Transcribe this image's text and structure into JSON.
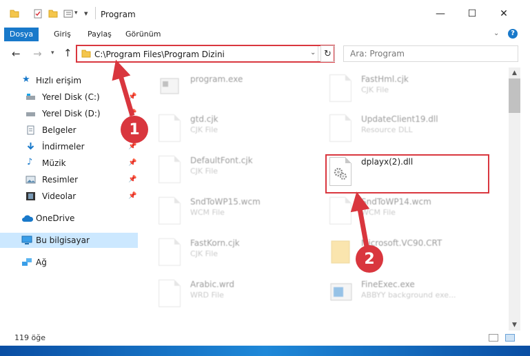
{
  "window": {
    "title": "Program",
    "controls": {
      "minimize": "—",
      "maximize": "☐",
      "close": "✕"
    }
  },
  "ribbon": {
    "tabs": [
      "Dosya",
      "Giriş",
      "Paylaş",
      "Görünüm"
    ],
    "help": "?"
  },
  "address": {
    "path": "C:\\Program Files\\Program Dizini",
    "refresh": "↻",
    "search_placeholder": "Ara: Program"
  },
  "nav": {
    "quick_access": "Hızlı erişim",
    "items": [
      {
        "label": "Yerel Disk (C:)",
        "icon": "drive-icon"
      },
      {
        "label": "Yerel Disk (D:)",
        "icon": "drive-icon"
      },
      {
        "label": "Belgeler",
        "icon": "documents-icon"
      },
      {
        "label": "İndirmeler",
        "icon": "download-icon"
      },
      {
        "label": "Müzik",
        "icon": "music-icon"
      },
      {
        "label": "Resimler",
        "icon": "pictures-icon"
      },
      {
        "label": "Videolar",
        "icon": "videos-icon"
      }
    ],
    "onedrive": "OneDrive",
    "this_pc": "Bu bilgisayar",
    "network": "Ağ"
  },
  "files": {
    "left": [
      {
        "name": "program.exe",
        "type": ""
      },
      {
        "name": "gtd.cjk",
        "type": "CJK File"
      },
      {
        "name": "DefaultFont.cjk",
        "type": "CJK File"
      },
      {
        "name": "SndToWP15.wcm",
        "type": "WCM File"
      },
      {
        "name": "FastKorn.cjk",
        "type": "CJK File"
      },
      {
        "name": "Arabic.wrd",
        "type": "WRD File"
      }
    ],
    "right": [
      {
        "name": "FastHml.cjk",
        "type": "CJK File"
      },
      {
        "name": "UpdateClient19.dll",
        "type": "Resource DLL"
      },
      {
        "name": "dplayx(2).dll",
        "type": ""
      },
      {
        "name": "SndToWP14.wcm",
        "type": "WCM File"
      },
      {
        "name": "Microsoft.VC90.CRT",
        "type": ""
      },
      {
        "name": "FineExec.exe",
        "type": "ABBYY background exe..."
      }
    ]
  },
  "status": {
    "count": "119 öğe"
  },
  "callouts": {
    "one": "1",
    "two": "2"
  },
  "colors": {
    "accent": "#1979ca",
    "highlight": "#d9363e",
    "selection": "#cce8ff"
  }
}
